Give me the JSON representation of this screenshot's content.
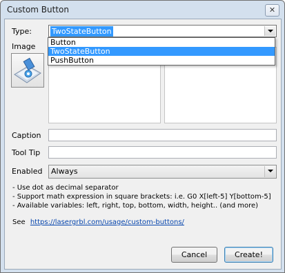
{
  "window": {
    "title": "Custom Button",
    "close_glyph": "✕"
  },
  "form": {
    "type_label": "Type:",
    "type_value": "TwoStateButton",
    "type_options": [
      "Button",
      "TwoStateButton",
      "PushButton"
    ],
    "image_label": "Image",
    "caption_label": "Caption",
    "caption_value": "",
    "tooltip_label": "Tool Tip",
    "tooltip_value": "",
    "enabled_label": "Enabled",
    "enabled_value": "Always"
  },
  "notes": [
    "- Use dot as decimal separator",
    "- Support math expression in square brackets: i.e. G0 X[left-5] Y[bottom-5]",
    "- Available variables: left, right, top, bottom, width, height.. (and more)"
  ],
  "see": {
    "prefix": "See",
    "link": "https://lasergrbl.com/usage/custom-buttons/"
  },
  "buttons": {
    "cancel": "Cancel",
    "create": "Create!"
  },
  "colors": {
    "selection": "#3399ff",
    "link": "#0645ad",
    "title_bar": "#d3e0ee"
  },
  "icons": {
    "image_button": "laser-engraving-icon",
    "close": "close-icon"
  }
}
